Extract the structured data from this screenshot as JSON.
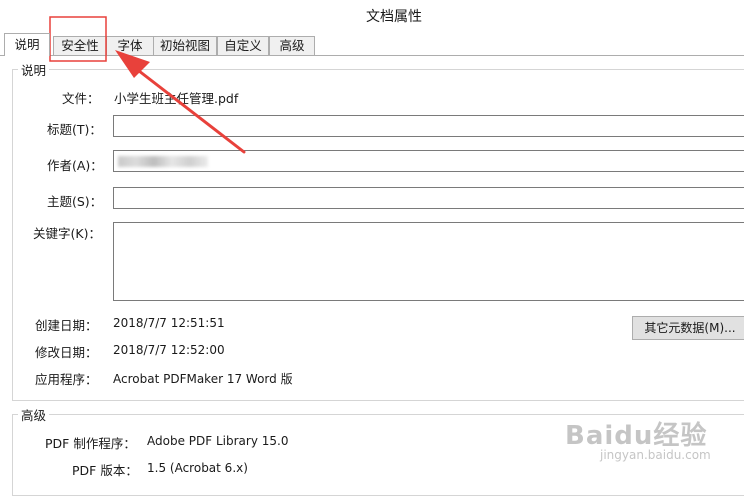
{
  "window": {
    "title": "文档属性"
  },
  "tabs": [
    {
      "label": "说明",
      "active": true
    },
    {
      "label": "安全性",
      "active": false
    },
    {
      "label": "字体",
      "active": false
    },
    {
      "label": "初始视图",
      "active": false
    },
    {
      "label": "自定义",
      "active": false
    },
    {
      "label": "高级",
      "active": false
    }
  ],
  "description": {
    "group_label": "说明",
    "file_label": "文件：",
    "file_value": "小学生班主任管理.pdf",
    "title_label": "标题(T)：",
    "title_value": "",
    "author_label": "作者(A)：",
    "subject_label": "主题(S)：",
    "subject_value": "",
    "keywords_label": "关键字(K)：",
    "keywords_value": "",
    "created_label": "创建日期：",
    "created_value": "2018/7/7 12:51:51",
    "modified_label": "修改日期：",
    "modified_value": "2018/7/7 12:52:00",
    "app_label": "应用程序：",
    "app_value": "Acrobat PDFMaker 17 Word 版",
    "metadata_button": "其它元数据(M)..."
  },
  "advanced": {
    "group_label": "高级",
    "producer_label": "PDF 制作程序：",
    "producer_value": "Adobe PDF Library 15.0",
    "version_label": "PDF 版本：",
    "version_value": "1.5 (Acrobat 6.x)"
  },
  "annotation": {
    "color": "#e8413b"
  },
  "watermark": {
    "text": "Baidu经验",
    "url": "jingyan.baidu.com"
  }
}
